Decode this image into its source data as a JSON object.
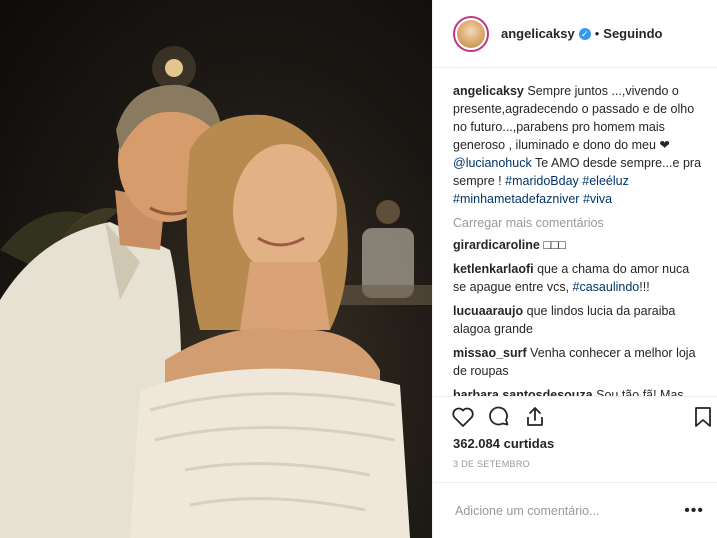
{
  "post": {
    "username": "angelicaksy",
    "follow_status": "Seguindo",
    "separator": "•",
    "verified_glyph": "✓",
    "caption": {
      "text1": "Sempre juntos ...,vivendo o presente,agradecendo o passado e de olho no futuro...,parabens pro homem mais generoso , iluminado e dono do meu ❤",
      "mention": "@lucianohuck",
      "text2": "Te AMO desde sempre...e pra sempre !",
      "hashtag1": "#maridoBday",
      "hashtag2": "#eleéluz",
      "hashtag3": "#minhametadefazniver",
      "hashtag4": "#viva"
    },
    "load_more": "Carregar mais comentários",
    "comments": [
      {
        "user": "girardicaroline",
        "text": "□□□"
      },
      {
        "user": "ketlenkarlaofi",
        "text": "que a chama do amor nuca se apague entre vcs,",
        "tag": "#casaulindo",
        "tail": "!!!"
      },
      {
        "user": "lucuaaraujo",
        "text": "que lindos lucia da paraiba alagoa grande"
      },
      {
        "user": "missao_surf",
        "text": "Venha conhecer a melhor loja de roupas"
      },
      {
        "user": "barbara.santosdesouza",
        "text": "Sou tão fã! Mas morro de medo de te conhecer! Já viu isso? Bem"
      }
    ],
    "likes": "362.084 curtidas",
    "date": "3 DE SETEMBRO",
    "comment_placeholder": "Adicione um comentário...",
    "more_options": "•••",
    "icons": [
      "heart-icon",
      "comment-icon",
      "share-icon",
      "bookmark-icon"
    ],
    "colors": {
      "link": "#003569",
      "verified": "#3897f0",
      "story_ring": "#c13584",
      "muted": "#999999"
    }
  }
}
